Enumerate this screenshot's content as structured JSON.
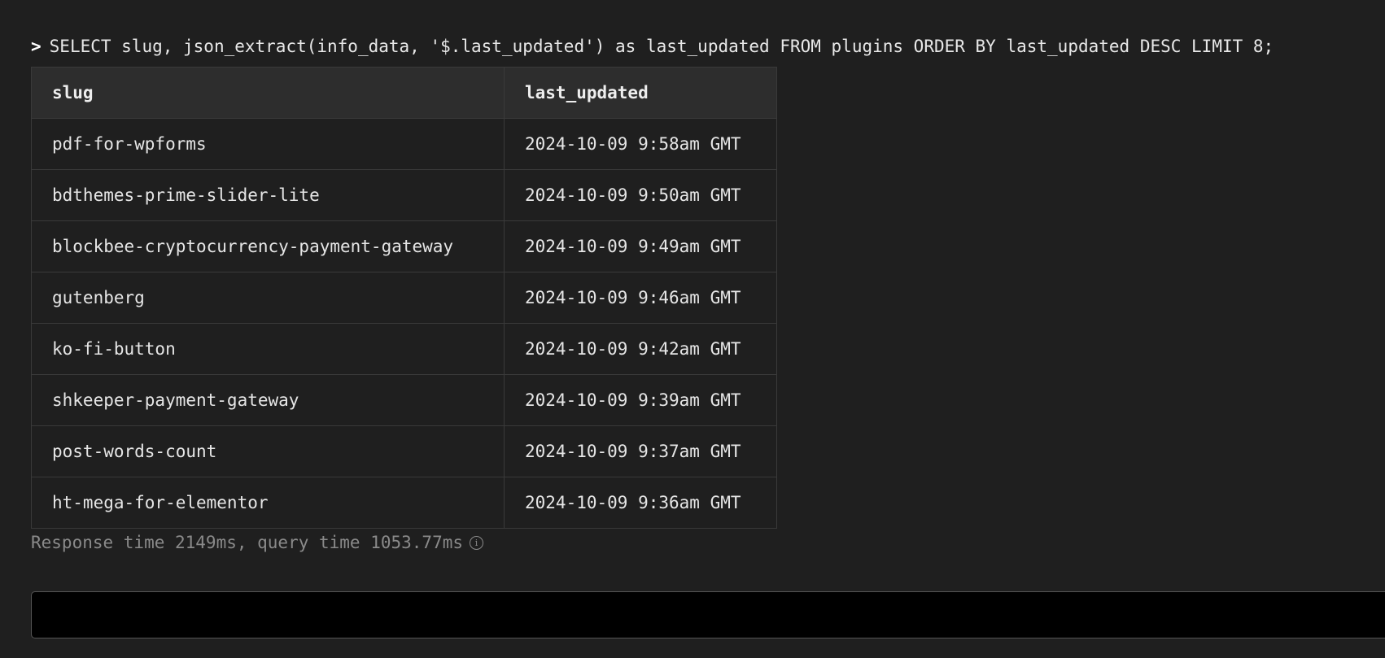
{
  "query": {
    "prompt": ">",
    "text": "SELECT slug, json_extract(info_data, '$.last_updated') as last_updated FROM plugins ORDER BY last_updated DESC LIMIT 8;"
  },
  "results": {
    "columns": [
      "slug",
      "last_updated"
    ],
    "rows": [
      [
        "pdf-for-wpforms",
        "2024-10-09 9:58am GMT"
      ],
      [
        "bdthemes-prime-slider-lite",
        "2024-10-09 9:50am GMT"
      ],
      [
        "blockbee-cryptocurrency-payment-gateway",
        "2024-10-09 9:49am GMT"
      ],
      [
        "gutenberg",
        "2024-10-09 9:46am GMT"
      ],
      [
        "ko-fi-button",
        "2024-10-09 9:42am GMT"
      ],
      [
        "shkeeper-payment-gateway",
        "2024-10-09 9:39am GMT"
      ],
      [
        "post-words-count",
        "2024-10-09 9:37am GMT"
      ],
      [
        "ht-mega-for-elementor",
        "2024-10-09 9:36am GMT"
      ]
    ]
  },
  "meta": {
    "response_text": "Response time 2149ms, query time 1053.77ms",
    "info_icon": "info-icon"
  },
  "input": {
    "value": "",
    "placeholder": ""
  },
  "colors": {
    "background": "#1f1f1f",
    "header_bg": "#2d2d2d",
    "input_bg": "#000000",
    "muted_text": "#8a8a8a"
  }
}
